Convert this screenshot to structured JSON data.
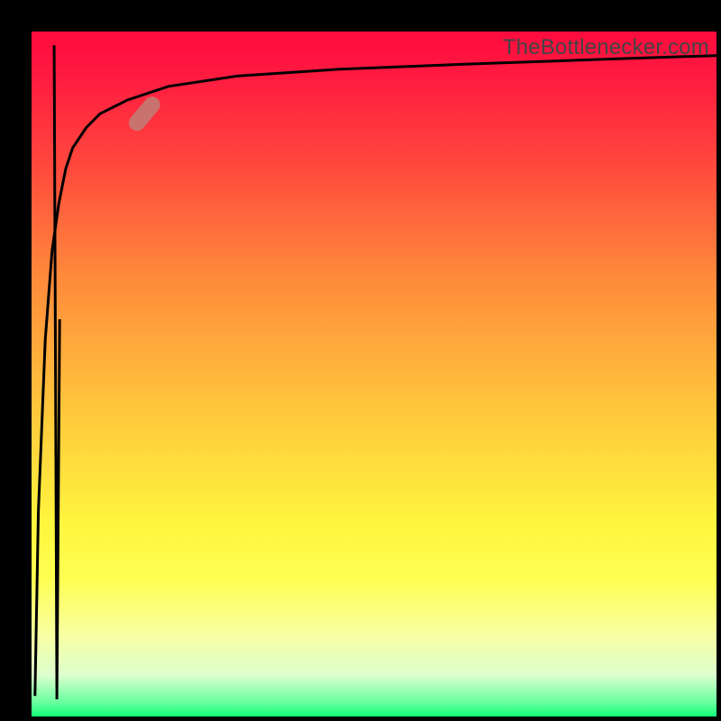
{
  "branding": {
    "text": "TheBottlenecker.com"
  },
  "colors": {
    "background": "#000000",
    "curve": "#000000",
    "marker": "#be7f76"
  },
  "chart_data": {
    "type": "line",
    "title": "",
    "xlabel": "",
    "ylabel": "",
    "xlim": [
      0,
      100
    ],
    "ylim": [
      0,
      100
    ],
    "series": [
      {
        "name": "bottleneck-curve",
        "x": [
          0.5,
          1,
          2,
          3,
          4,
          5,
          6,
          8,
          10,
          14,
          20,
          30,
          45,
          65,
          85,
          100
        ],
        "y": [
          3,
          30,
          55,
          68,
          75,
          80,
          83,
          86,
          88,
          90,
          92,
          93.5,
          94.5,
          95.3,
          96,
          96.5
        ]
      },
      {
        "name": "spike-down",
        "x": [
          3.3,
          3.7,
          4.1
        ],
        "y": [
          98,
          2.5,
          58
        ]
      }
    ],
    "marker": {
      "x": 16.5,
      "y": 88,
      "angle_deg": -50
    },
    "gradient_stops": [
      {
        "pos": 0.0,
        "color": "#ff0b3e"
      },
      {
        "pos": 0.4,
        "color": "#ff9a3a"
      },
      {
        "pos": 0.75,
        "color": "#fff63e"
      },
      {
        "pos": 0.95,
        "color": "#bfffcc"
      },
      {
        "pos": 1.0,
        "color": "#12ff76"
      }
    ]
  }
}
